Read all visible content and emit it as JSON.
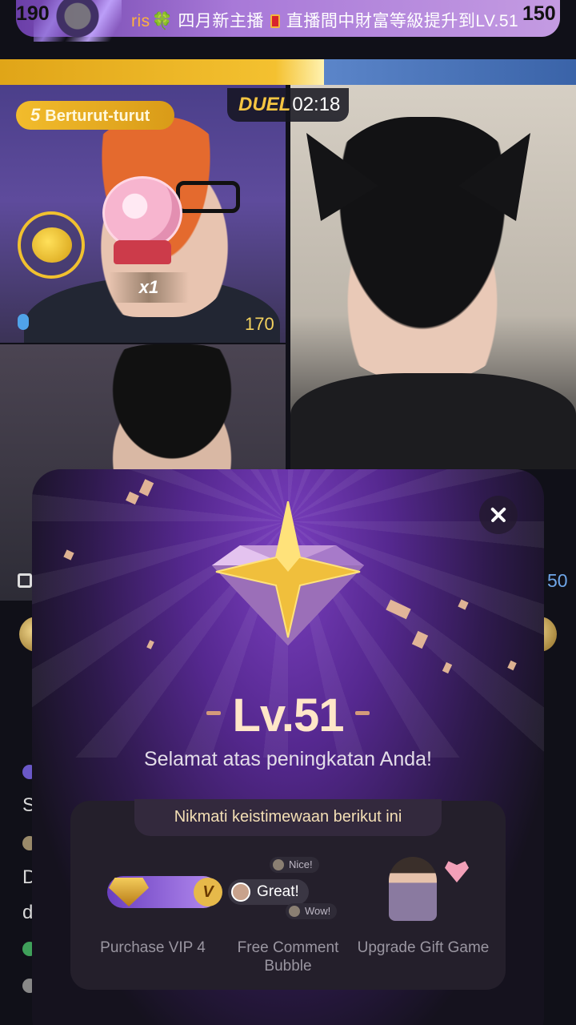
{
  "banner": {
    "username": "ris",
    "clover": "🍀",
    "text1": "四月新主播",
    "text2": "直播間中財富等級提升到LV.51"
  },
  "duel": {
    "left_score": "190",
    "right_score": "150",
    "logo": "DUEL",
    "timer": "02:18",
    "streak_count": "5",
    "streak_label": "Berturut-turut",
    "gift_multiplier": "x1",
    "panel_score": "170",
    "edge_score": "50"
  },
  "chat_edge": {
    "line1": "S",
    "line2": "D",
    "line3": "d"
  },
  "modal": {
    "level": "Lv.51",
    "congrats": "Selamat atas peningkatan Anda!",
    "perks_title": "Nikmati keistimewaan berikut ini",
    "perks": [
      {
        "label": "Purchase VIP 4",
        "icon": "vip-card-icon"
      },
      {
        "label": "Free Comment Bubble",
        "icon": "comment-bubble-icon"
      },
      {
        "label": "Upgrade Gift Game",
        "icon": "gift-game-icon"
      }
    ],
    "bubble_nice": "Nice!",
    "bubble_great": "Great!",
    "bubble_wow": "Wow!",
    "vip_letter": "V"
  },
  "colors": {
    "left_team": "#f4c130",
    "right_team": "#3a63a8",
    "modal_accent": "#ffe6c8"
  }
}
